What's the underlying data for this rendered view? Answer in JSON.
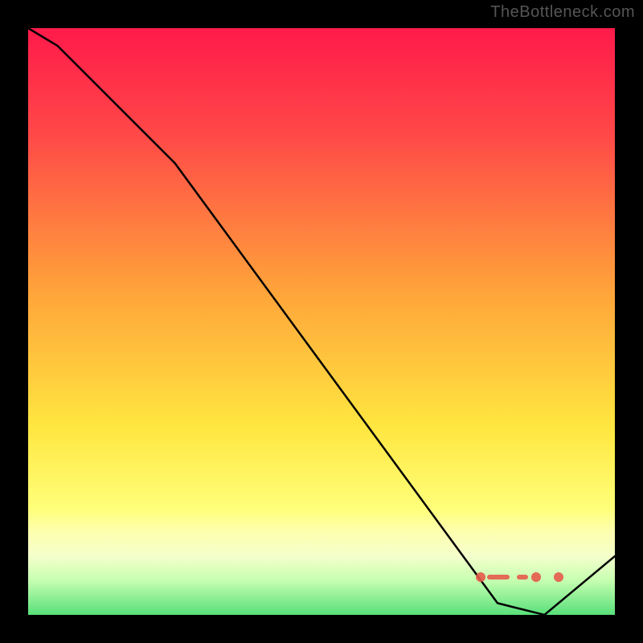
{
  "attribution": "TheBottleneck.com",
  "chart_data": {
    "type": "line",
    "title": "",
    "xlabel": "",
    "ylabel": "",
    "x": [
      0.0,
      0.05,
      0.25,
      0.8,
      0.88,
      1.0
    ],
    "values": [
      1.0,
      0.97,
      0.77,
      0.02,
      0.0,
      0.1
    ],
    "ylim": [
      0,
      1
    ],
    "xlim": [
      0,
      1
    ],
    "gradient_stops": [
      {
        "t": 0.0,
        "color": "#ff1a4a"
      },
      {
        "t": 0.18,
        "color": "#ff4848"
      },
      {
        "t": 0.45,
        "color": "#ffa43a"
      },
      {
        "t": 0.68,
        "color": "#ffe640"
      },
      {
        "t": 0.82,
        "color": "#ffff7a"
      },
      {
        "t": 0.9,
        "color": "#f4ffcb"
      },
      {
        "t": 1.0,
        "color": "#58e07a"
      }
    ],
    "marker_band": {
      "y": 0.06,
      "x_start": 0.77,
      "x_end": 0.9,
      "color": "#e55a4a",
      "style": "dashed-dots"
    }
  }
}
